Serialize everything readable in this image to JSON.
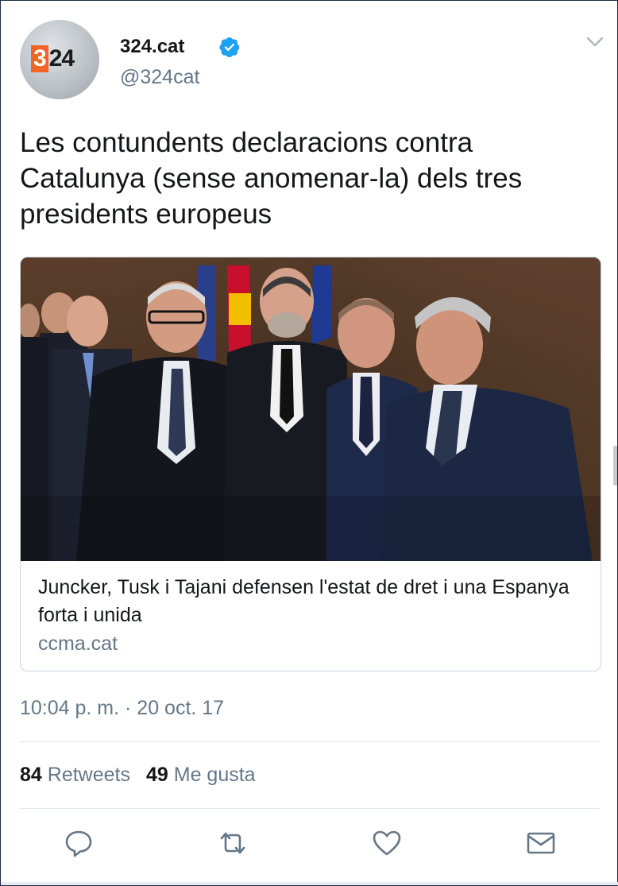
{
  "author": {
    "name": "324.cat",
    "handle": "@324cat",
    "avatar_logo_highlight": "3",
    "avatar_logo_rest": "24",
    "verified": true,
    "brand_color": "#f26522"
  },
  "tweet": {
    "text": "Les contundents declaracions contra Catalunya (sense anomenar-la) dels tres presidents europeus",
    "timestamp": "10:04 p. m. · 20 oct. 17"
  },
  "card": {
    "title": "Juncker, Tusk i Tajani defensen l'estat de dret i una Espanya forta i unida",
    "domain": "ccma.cat",
    "image_alt": "photo"
  },
  "stats": {
    "retweets_count": "84",
    "retweets_label": "Retweets",
    "likes_count": "49",
    "likes_label": "Me gusta"
  },
  "icons": {
    "verified": "verified-badge-icon",
    "menu": "chevron-down-icon",
    "reply": "reply-icon",
    "retweet": "retweet-icon",
    "like": "heart-icon",
    "message": "envelope-icon"
  },
  "colors": {
    "text_primary": "#14171a",
    "text_secondary": "#657786",
    "verified_blue": "#1da1f2",
    "border": "#ccd6dd"
  }
}
